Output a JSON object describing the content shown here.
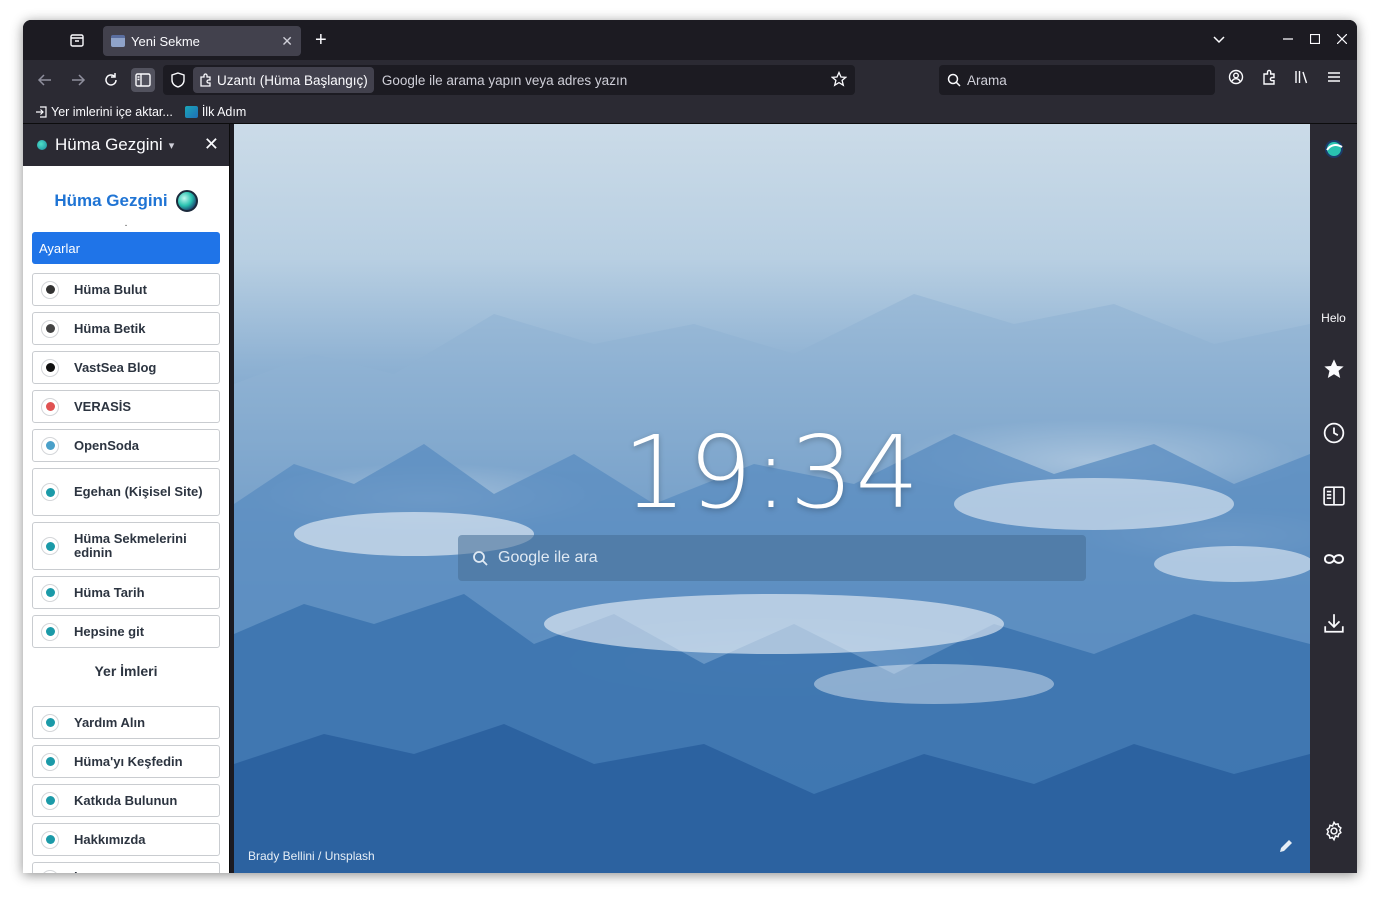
{
  "tabs": [
    {
      "title": "Yeni Sekme"
    }
  ],
  "navbar": {
    "extension_chip": "Uzantı (Hüma Başlangıç)",
    "url_placeholder": "Google ile arama yapın veya adres yazın",
    "search_placeholder": "Arama"
  },
  "bookmarks_bar": [
    {
      "label": "Yer imlerini içe aktar...",
      "icon": "import-icon"
    },
    {
      "label": "İlk Adım",
      "icon": "huma-favicon"
    }
  ],
  "sidebar": {
    "header_title": "Hüma Gezgini",
    "brand": "Hüma Gezgini",
    "brand_dot": ".",
    "settings_button": "Ayarlar",
    "links": [
      {
        "label": "Hüma Bulut",
        "icon_color": "#333333"
      },
      {
        "label": "Hüma Betik",
        "icon_color": "#444444"
      },
      {
        "label": "VastSea Blog",
        "icon_color": "#111111"
      },
      {
        "label": "VERASİS",
        "icon_color": "#e05252"
      },
      {
        "label": "OpenSoda",
        "icon_color": "#4aa0c9"
      },
      {
        "label": "Egehan (Kişisel Site)",
        "icon_color": "#1b9aa8"
      },
      {
        "label": "Hüma Sekmelerini edinin",
        "icon_color": "#1b9aa8"
      },
      {
        "label": "Hüma Tarih",
        "icon_color": "#1b9aa8"
      },
      {
        "label": "Hepsine git",
        "icon_color": "#1b9aa8"
      }
    ],
    "bookmarks_title": "Yer İmleri",
    "bookmark_links": [
      {
        "label": "Yardım Alın",
        "icon_color": "#1b9aa8"
      },
      {
        "label": "Hüma'yı Keşfedin",
        "icon_color": "#1b9aa8"
      },
      {
        "label": "Katkıda Bulunun",
        "icon_color": "#1b9aa8"
      },
      {
        "label": "Hakkımızda",
        "icon_color": "#1b9aa8"
      },
      {
        "label": "İlk Adım",
        "icon_color": "#1b9aa8"
      }
    ]
  },
  "newtab": {
    "clock": "19:34",
    "search_placeholder": "Google ile ara",
    "photo_credit": "Brady Bellini / Unsplash"
  },
  "right_sidebar": {
    "helo_label": "Helo",
    "icons": [
      "huma-logo-icon",
      "star-icon",
      "history-icon",
      "reader-icon",
      "private-mask-icon",
      "download-icon",
      "settings-gear-icon"
    ]
  },
  "colors": {
    "accent": "#1f74e8",
    "brand_text": "#1f74d4"
  }
}
